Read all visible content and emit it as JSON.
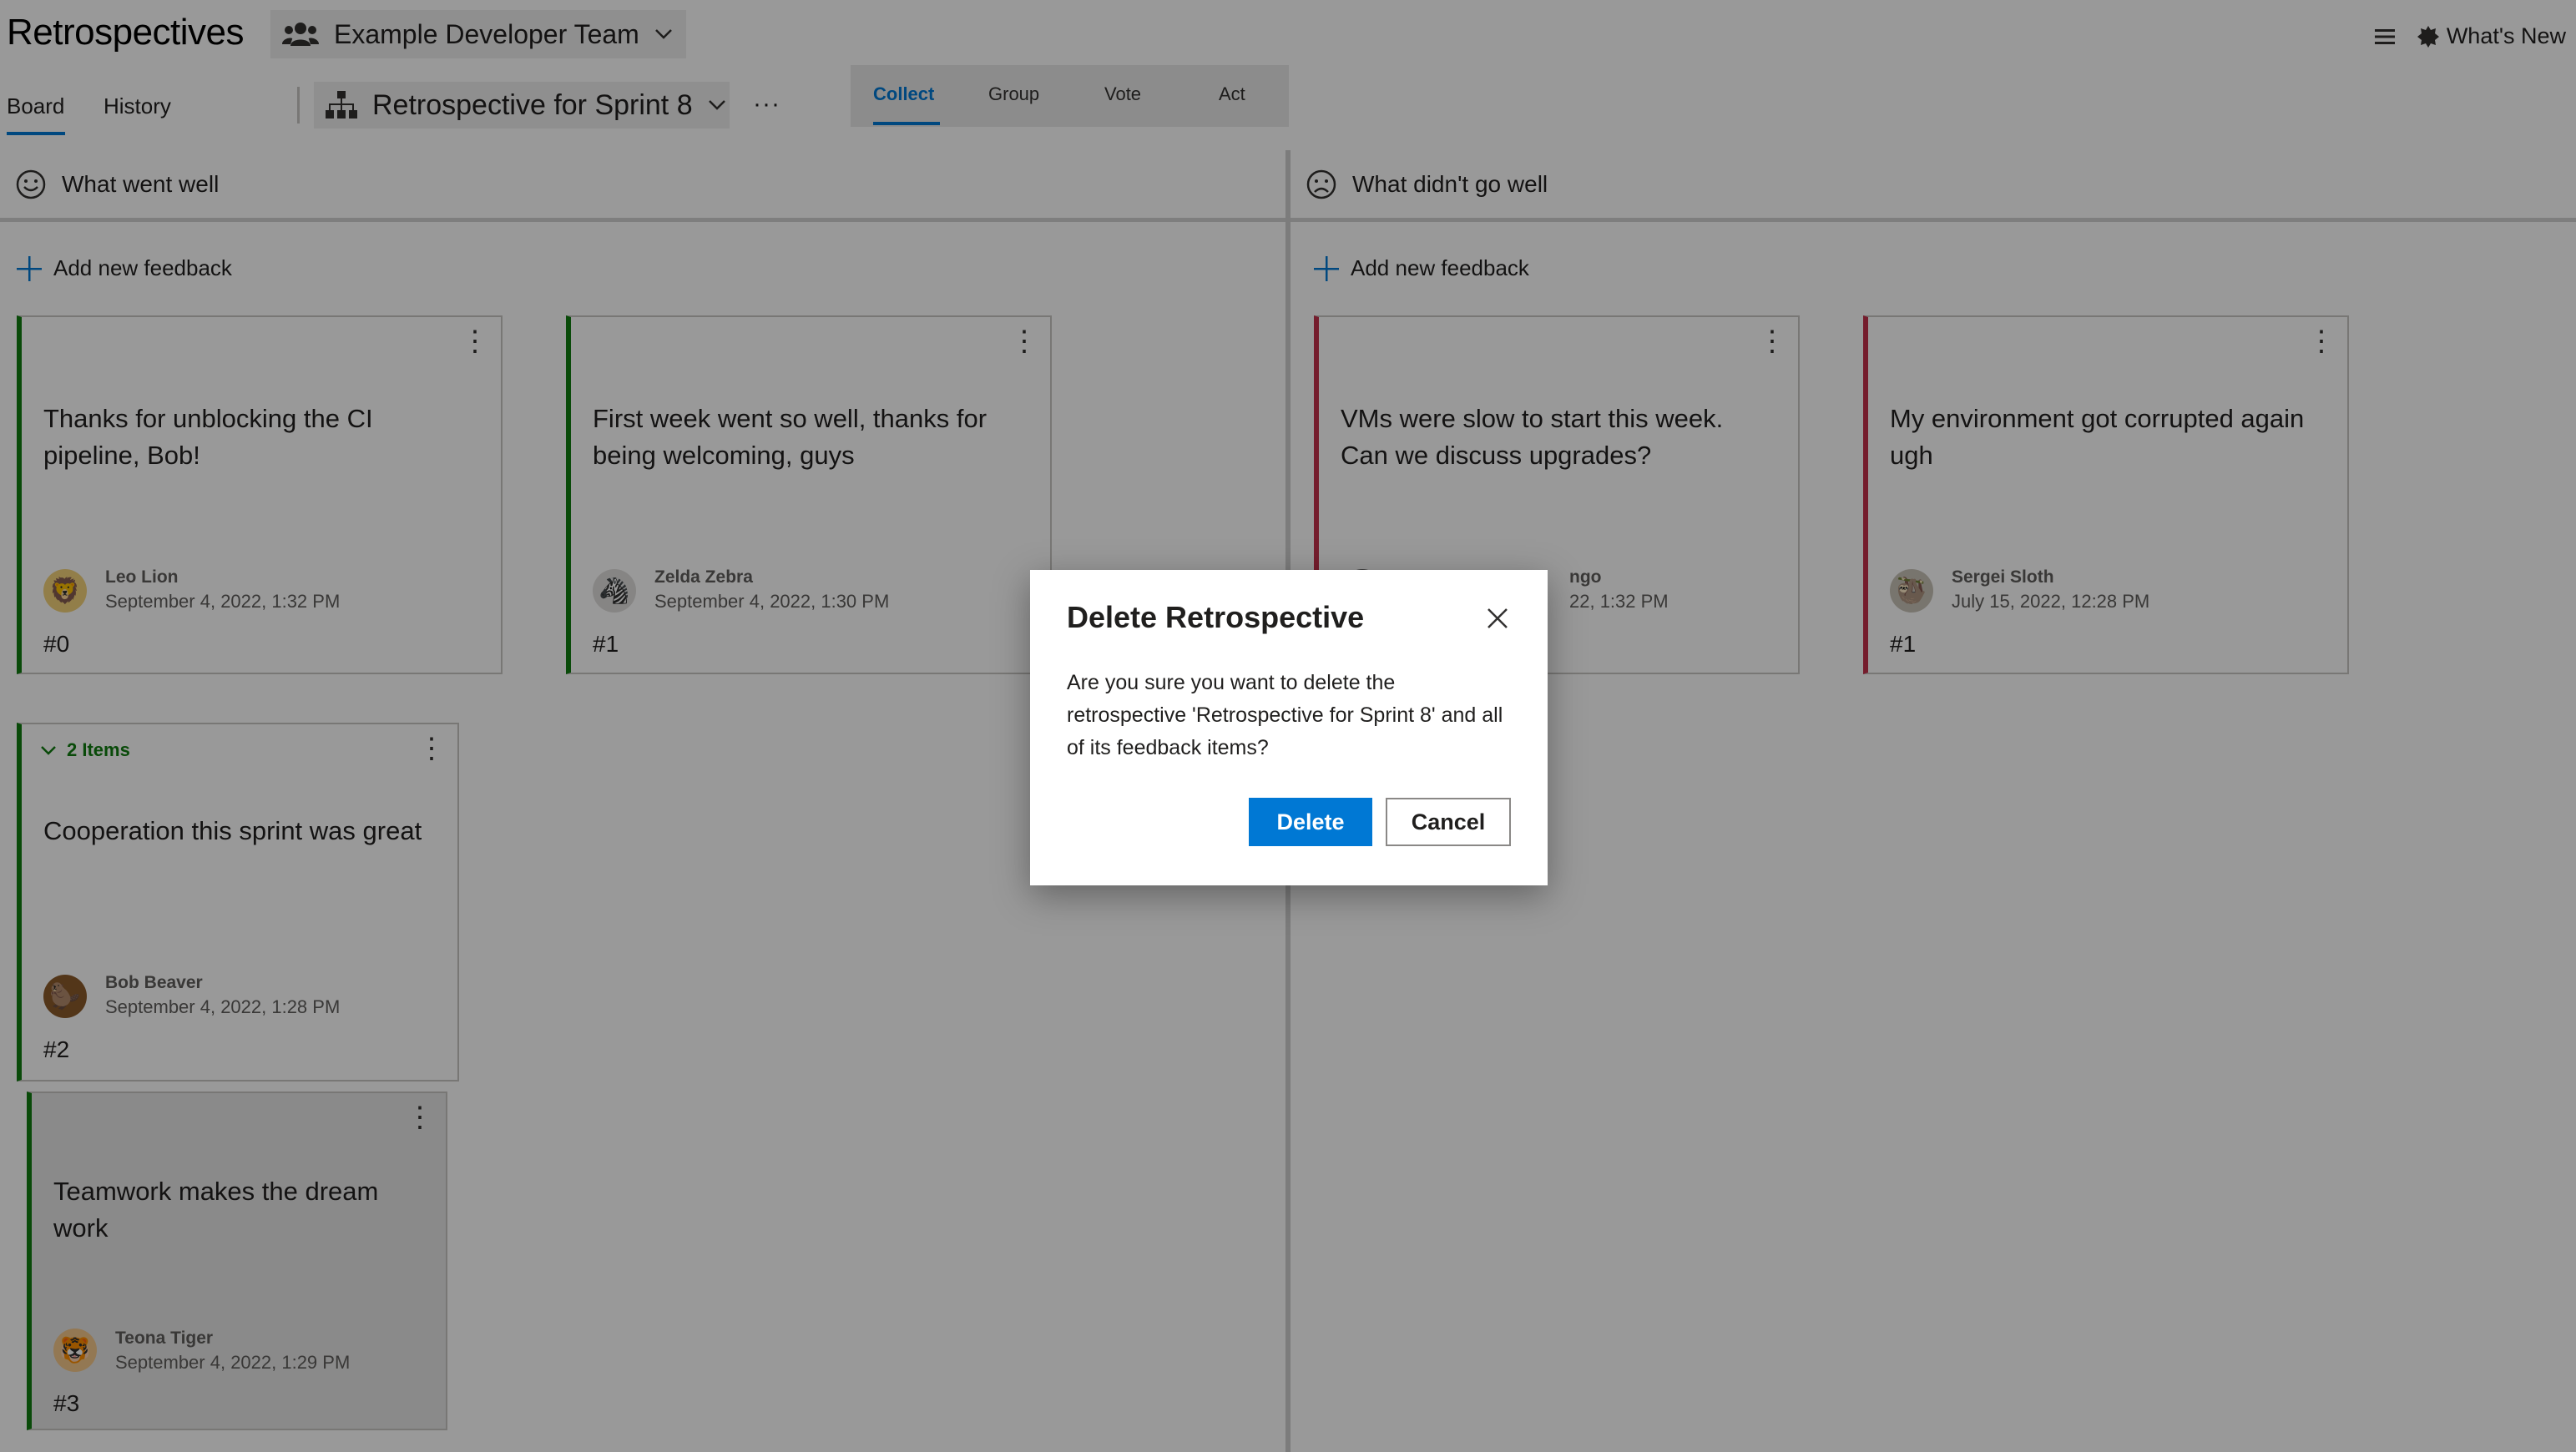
{
  "app": {
    "title": "Retrospectives"
  },
  "header": {
    "team_selector": {
      "label": "Example Developer Team",
      "icon": "people-icon"
    },
    "menu_icon": "hamburger-menu-icon",
    "whats_new": "What's New"
  },
  "nav": {
    "tabs": [
      {
        "label": "Board",
        "active": true
      },
      {
        "label": "History",
        "active": false
      }
    ],
    "retro_selector": {
      "label": "Retrospective for Sprint 8",
      "icon": "org-chart-icon"
    },
    "more": "···"
  },
  "phases": [
    {
      "label": "Collect",
      "active": true
    },
    {
      "label": "Group",
      "active": false
    },
    {
      "label": "Vote",
      "active": false
    },
    {
      "label": "Act",
      "active": false
    }
  ],
  "columns": [
    {
      "title": "What went well",
      "icon": "smile-icon",
      "accent": "#107c10",
      "add_label": "Add new feedback",
      "cards": [
        {
          "text": "Thanks for unblocking the CI pipeline, Bob!",
          "author": "Leo Lion",
          "date": "September 4, 2022, 1:32 PM",
          "number": "#0",
          "avatar": "lion-avatar"
        },
        {
          "text": "First week went so well, thanks for being welcoming, guys",
          "author": "Zelda Zebra",
          "date": "September 4, 2022, 1:30 PM",
          "number": "#1",
          "avatar": "zebra-avatar"
        }
      ],
      "group": {
        "toggle_label": "2 Items",
        "parent": {
          "text": "Cooperation this sprint was great",
          "author": "Bob Beaver",
          "date": "September 4, 2022, 1:28 PM",
          "number": "#2",
          "avatar": "beaver-avatar"
        },
        "child": {
          "text": "Teamwork makes the dream work",
          "author": "Teona Tiger",
          "date": "September 4, 2022, 1:29 PM",
          "number": "#3",
          "avatar": "tiger-avatar"
        }
      }
    },
    {
      "title": "What didn't go well",
      "icon": "frown-icon",
      "accent": "#c4314b",
      "add_label": "Add new feedback",
      "cards": [
        {
          "text": "VMs were slow to start this week. Can we discuss upgrades?",
          "author_partial": "ngo",
          "date_partial": "22, 1:32 PM",
          "avatar": "flamingo-avatar"
        },
        {
          "text": "My environment got corrupted again ugh",
          "author": "Sergei Sloth",
          "date": "July 15, 2022, 12:28 PM",
          "number": "#1",
          "avatar": "sloth-avatar"
        }
      ]
    }
  ],
  "dialog": {
    "title": "Delete Retrospective",
    "message": "Are you sure you want to delete the retrospective 'Retrospective for Sprint 8' and all of its feedback items?",
    "confirm_label": "Delete",
    "cancel_label": "Cancel",
    "close_icon": "close-icon"
  }
}
